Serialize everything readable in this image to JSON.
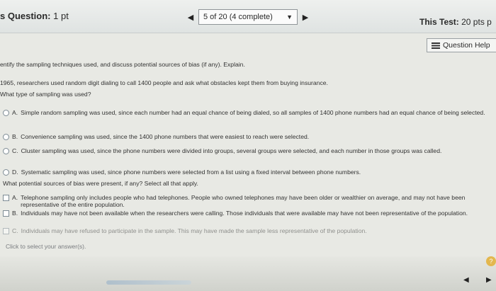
{
  "header": {
    "question_prefix": "s Question:",
    "question_points": "1 pt",
    "progress": "5 of 20 (4 complete)",
    "test_label": "This Test:",
    "test_points": "20 pts p"
  },
  "help": {
    "label": "Question Help"
  },
  "question": {
    "line1": "entify the sampling techniques used, and discuss potential sources of bias (if any). Explain.",
    "line2": "1965, researchers used random digit dialing to call 1400 people and ask what obstacles kept them from buying insurance.",
    "prompt": "What type of sampling was used?",
    "options": [
      {
        "letter": "A.",
        "text": "Simple random sampling was used, since each number had an equal chance of being dialed, so all samples of 1400 phone numbers had an equal chance of being selected."
      },
      {
        "letter": "B.",
        "text": "Convenience sampling was used, since the 1400 phone numbers that were easiest to reach were selected."
      },
      {
        "letter": "C.",
        "text": "Cluster sampling was used, since the phone numbers were divided into groups, several groups were selected, and each number in those groups was called."
      },
      {
        "letter": "D.",
        "text": "Systematic sampling was used, since phone numbers were selected from a list using a fixed interval between phone numbers."
      }
    ],
    "bias_prompt": "What potential sources of bias were present, if any? Select all that apply.",
    "bias_options": [
      {
        "letter": "A.",
        "text": "Telephone sampling only includes people who had telephones. People who owned telephones may have been older or wealthier on average, and may not have been representative of the entire population."
      },
      {
        "letter": "B.",
        "text": "Individuals may have not been available when the researchers were calling. Those individuals that were available may have not been representative of the population."
      },
      {
        "letter": "C.",
        "text": "Individuals may have refused to participate in the sample. This may have made the sample less representative of the population."
      }
    ]
  },
  "footer": {
    "hint": "Click to select your answer(s)."
  }
}
